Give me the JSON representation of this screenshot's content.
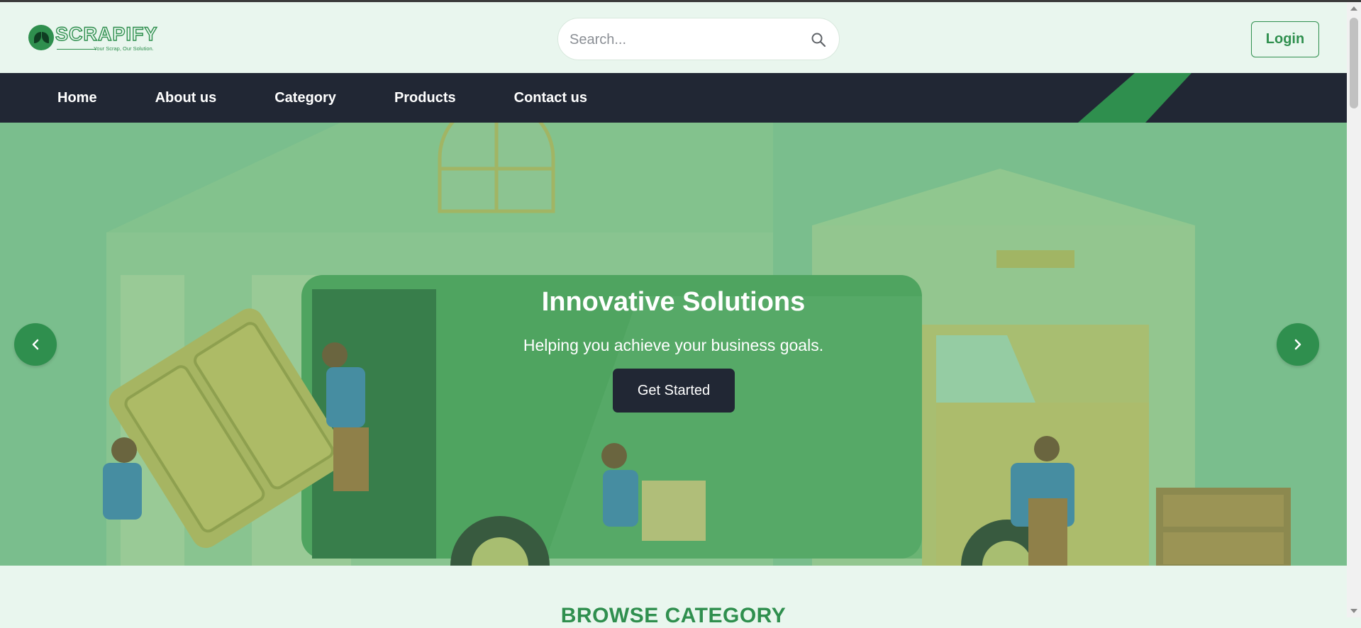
{
  "brand": {
    "name": "SCRAPIFY",
    "tagline": "Your Scrap, Our Solution."
  },
  "search": {
    "placeholder": "Search...",
    "icon": "search-icon"
  },
  "header": {
    "login_label": "Login"
  },
  "nav": {
    "items": [
      "Home",
      "About us",
      "Category",
      "Products",
      "Contact us"
    ]
  },
  "hero": {
    "title": "Innovative Solutions",
    "subtitle": "Helping you achieve your business goals.",
    "cta_label": "Get Started",
    "prev_icon": "chevron-left-icon",
    "next_icon": "chevron-right-icon"
  },
  "section": {
    "title": "BROWSE CATEGORY"
  },
  "colors": {
    "brand_green": "#2f8f4e",
    "nav_bg": "#212734",
    "page_bg": "#e9f6ee",
    "hero_overlay": "#89c398"
  }
}
